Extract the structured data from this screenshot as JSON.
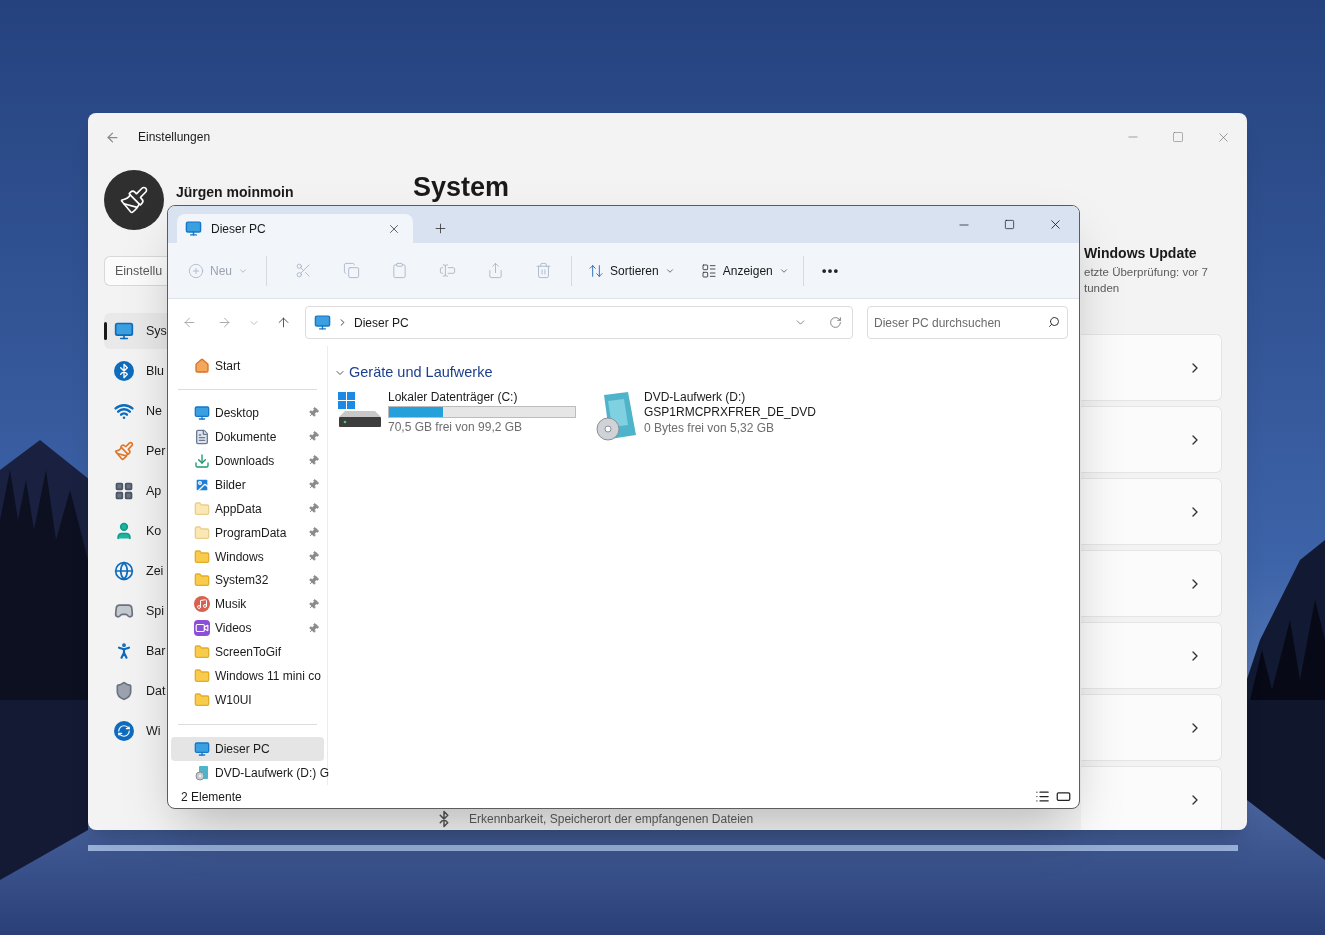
{
  "settings": {
    "title": "Einstellungen",
    "user_name": "Jürgen moinmoin",
    "search_placeholder": "Einstellu",
    "page_title": "System",
    "nav": [
      {
        "label": "Sys",
        "selected": true
      },
      {
        "label": "Blu",
        "selected": false
      },
      {
        "label": "Ne",
        "selected": false
      },
      {
        "label": "Per",
        "selected": false
      },
      {
        "label": "Ap",
        "selected": false
      },
      {
        "label": "Ko",
        "selected": false
      },
      {
        "label": "Zei",
        "selected": false
      },
      {
        "label": "Spi",
        "selected": false
      },
      {
        "label": "Bar",
        "selected": false
      },
      {
        "label": "Dat",
        "selected": false
      },
      {
        "label": "Wi",
        "selected": false
      }
    ],
    "update": {
      "title": "Windows Update",
      "lines": [
        "etzte Überprüfung: vor 7",
        "tunden"
      ]
    },
    "cards": [
      {
        "kind": "chevron"
      },
      {
        "kind": "chevron"
      },
      {
        "kind": "chevron"
      },
      {
        "kind": "chevron"
      },
      {
        "kind": "chevron"
      },
      {
        "kind": "chevron"
      },
      {
        "kind": "chevron",
        "subtitle": "Erkennbarkeit, Speicherort der empfangenen Dateien"
      }
    ]
  },
  "explorer": {
    "tabs": [
      {
        "title": "Dieser PC",
        "selected": true
      }
    ],
    "toolbar": {
      "new": {
        "label": "Neu",
        "disabled": true
      },
      "actions": [
        {
          "kind": "cut",
          "disabled": true
        },
        {
          "kind": "copy",
          "disabled": true
        },
        {
          "kind": "paste",
          "disabled": true
        },
        {
          "kind": "rename",
          "disabled": true
        },
        {
          "kind": "share",
          "disabled": true
        },
        {
          "kind": "delete",
          "disabled": true
        }
      ],
      "sort": "Sortieren",
      "view": "Anzeigen"
    },
    "address": "Dieser PC",
    "search_placeholder": "Dieser PC durchsuchen",
    "sidebar": {
      "home": {
        "label": "Start",
        "selected": false
      },
      "quick_access": [
        {
          "kind": "desktop",
          "label": "Desktop",
          "pinned": true,
          "selected": false
        },
        {
          "kind": "documents",
          "label": "Dokumente",
          "pinned": true,
          "selected": false
        },
        {
          "kind": "downloads",
          "label": "Downloads",
          "pinned": true,
          "selected": false
        },
        {
          "kind": "pictures",
          "label": "Bilder",
          "pinned": true,
          "selected": false
        },
        {
          "kind": "folder_light",
          "label": "AppData",
          "pinned": true,
          "selected": false
        },
        {
          "kind": "folder_light",
          "label": "ProgramData",
          "pinned": true,
          "selected": false
        },
        {
          "kind": "folder",
          "label": "Windows",
          "pinned": true,
          "selected": false
        },
        {
          "kind": "folder",
          "label": "System32",
          "pinned": true,
          "selected": false
        },
        {
          "kind": "music",
          "label": "Musik",
          "pinned": true,
          "selected": false
        },
        {
          "kind": "videos",
          "label": "Videos",
          "pinned": true,
          "selected": false
        },
        {
          "kind": "folder",
          "label": "ScreenToGif",
          "pinned": false,
          "selected": false
        },
        {
          "kind": "folder",
          "label": "Windows 11 mini co",
          "pinned": false,
          "selected": false
        },
        {
          "kind": "folder",
          "label": "W10UI",
          "pinned": false,
          "selected": false
        }
      ],
      "locations": [
        {
          "kind": "pc",
          "label": "Dieser PC",
          "selected": true
        },
        {
          "kind": "dvd",
          "label": "DVD-Laufwerk (D:) G",
          "selected": false
        }
      ]
    },
    "group": {
      "title": "Geräte und Laufwerke",
      "expanded": true
    },
    "drives": [
      {
        "kind": "disk",
        "name": "Lokaler Datenträger (C:)",
        "level": 0.29,
        "free": "70,5 GB frei von 99,2 GB"
      },
      {
        "kind": "optical",
        "name": "DVD-Laufwerk (D:)",
        "label": "GSP1RMCPRXFRER_DE_DVD",
        "free": "0 Bytes frei von 5,32 GB"
      }
    ],
    "status": "2 Elemente"
  }
}
